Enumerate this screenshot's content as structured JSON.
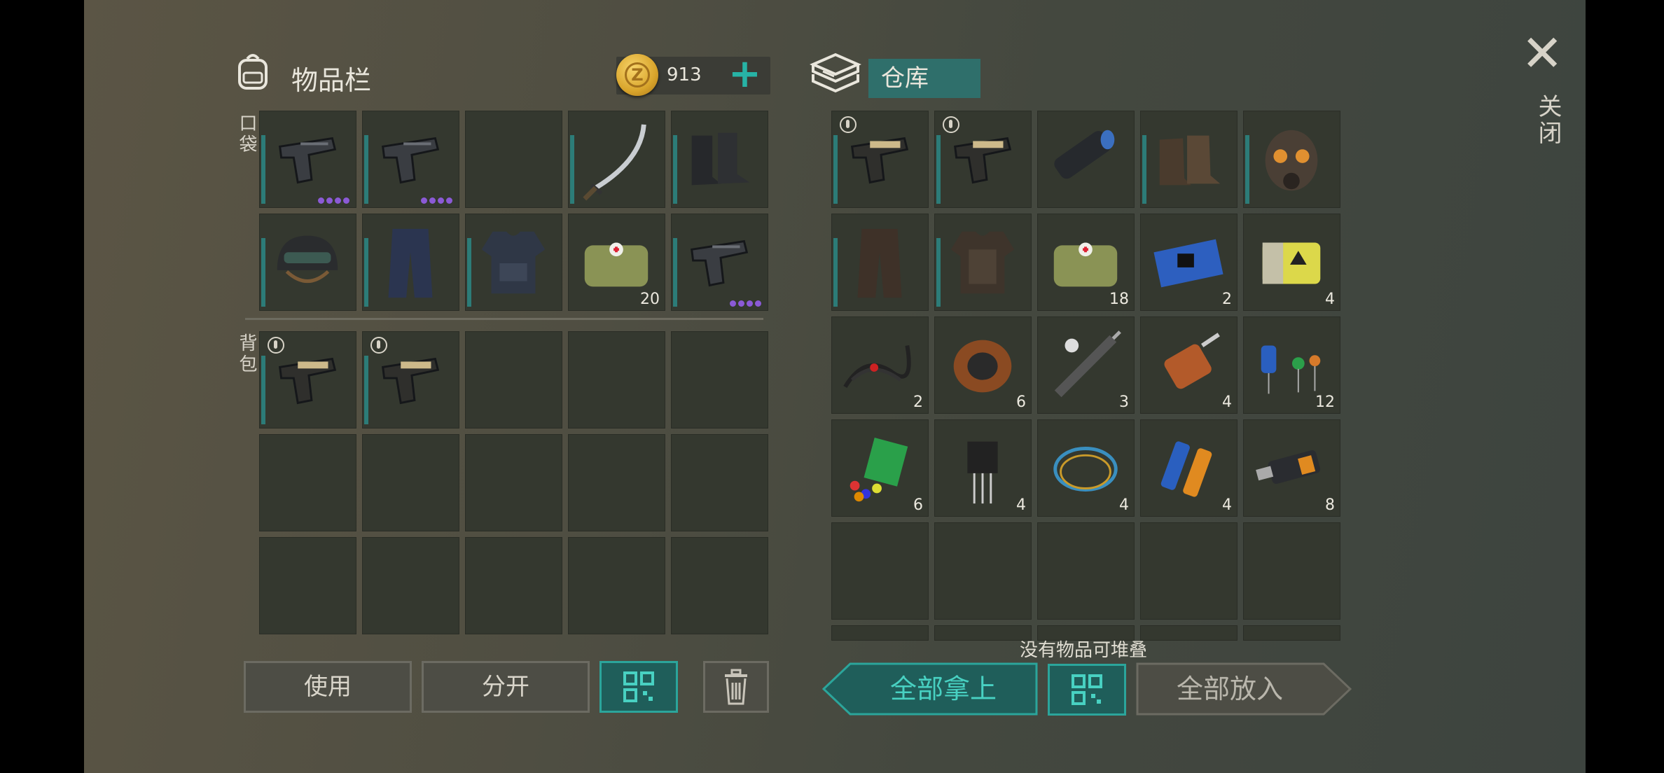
{
  "inventory": {
    "title": "物品栏",
    "coins": "913",
    "coin_letter": "Z",
    "pocket_label": "口袋",
    "backpack_label": "背包",
    "pockets": [
      {
        "icon": "pistol-icon",
        "count": "",
        "dots": 4,
        "badge": false,
        "dur": true
      },
      {
        "icon": "pistol-icon",
        "count": "",
        "dots": 4,
        "badge": false,
        "dur": true
      },
      {
        "icon": "",
        "count": "",
        "dots": 0,
        "badge": false,
        "dur": false
      },
      {
        "icon": "katana-icon",
        "count": "",
        "dots": 0,
        "badge": false,
        "dur": true
      },
      {
        "icon": "boots-icon",
        "count": "",
        "dots": 0,
        "badge": false,
        "dur": true
      },
      {
        "icon": "helmet-icon",
        "count": "",
        "dots": 0,
        "badge": false,
        "dur": true
      },
      {
        "icon": "pants-icon",
        "count": "",
        "dots": 0,
        "badge": false,
        "dur": true
      },
      {
        "icon": "vest-icon",
        "count": "",
        "dots": 0,
        "badge": false,
        "dur": true
      },
      {
        "icon": "medkit-icon",
        "count": "20",
        "dots": 0,
        "badge": false,
        "dur": false
      },
      {
        "icon": "pistol-icon",
        "count": "",
        "dots": 4,
        "badge": false,
        "dur": true
      }
    ],
    "backpack": [
      {
        "icon": "gold-pistol-icon",
        "count": "",
        "dots": 0,
        "badge": true,
        "dur": true
      },
      {
        "icon": "gold-pistol-icon",
        "count": "",
        "dots": 0,
        "badge": true,
        "dur": true
      },
      {
        "icon": "",
        "count": "",
        "dots": 0,
        "badge": false,
        "dur": false
      },
      {
        "icon": "",
        "count": "",
        "dots": 0,
        "badge": false,
        "dur": false
      },
      {
        "icon": "",
        "count": "",
        "dots": 0,
        "badge": false,
        "dur": false
      },
      {
        "icon": "",
        "count": "",
        "dots": 0,
        "badge": false,
        "dur": false
      },
      {
        "icon": "",
        "count": "",
        "dots": 0,
        "badge": false,
        "dur": false
      },
      {
        "icon": "",
        "count": "",
        "dots": 0,
        "badge": false,
        "dur": false
      },
      {
        "icon": "",
        "count": "",
        "dots": 0,
        "badge": false,
        "dur": false
      },
      {
        "icon": "",
        "count": "",
        "dots": 0,
        "badge": false,
        "dur": false
      },
      {
        "icon": "",
        "count": "",
        "dots": 0,
        "badge": false,
        "dur": false
      },
      {
        "icon": "",
        "count": "",
        "dots": 0,
        "badge": false,
        "dur": false
      },
      {
        "icon": "",
        "count": "",
        "dots": 0,
        "badge": false,
        "dur": false
      },
      {
        "icon": "",
        "count": "",
        "dots": 0,
        "badge": false,
        "dur": false
      },
      {
        "icon": "",
        "count": "",
        "dots": 0,
        "badge": false,
        "dur": false
      }
    ],
    "buttons": {
      "use": "使用",
      "split": "分开"
    }
  },
  "storage": {
    "title": "仓库",
    "items": [
      {
        "icon": "gold-pistol-icon",
        "count": "",
        "badge": true,
        "dur": true
      },
      {
        "icon": "gold-pistol-icon",
        "count": "",
        "badge": true,
        "dur": true
      },
      {
        "icon": "flashlight-icon",
        "count": "",
        "badge": false,
        "dur": false
      },
      {
        "icon": "leather-boots-icon",
        "count": "",
        "badge": false,
        "dur": true
      },
      {
        "icon": "gas-mask-icon",
        "count": "",
        "badge": false,
        "dur": true
      },
      {
        "icon": "leather-pants-icon",
        "count": "",
        "badge": false,
        "dur": true
      },
      {
        "icon": "leather-armor-icon",
        "count": "",
        "badge": false,
        "dur": true
      },
      {
        "icon": "medkit-icon",
        "count": "18",
        "badge": false,
        "dur": false
      },
      {
        "icon": "circuit-board-icon",
        "count": "2",
        "badge": false,
        "dur": false
      },
      {
        "icon": "battery-pack-icon",
        "count": "4",
        "badge": false,
        "dur": false
      },
      {
        "icon": "wires-icon",
        "count": "2",
        "badge": false,
        "dur": false
      },
      {
        "icon": "copper-coil-icon",
        "count": "6",
        "badge": false,
        "dur": false
      },
      {
        "icon": "soldering-iron-icon",
        "count": "3",
        "badge": false,
        "dur": false
      },
      {
        "icon": "electric-motor-icon",
        "count": "4",
        "badge": false,
        "dur": false
      },
      {
        "icon": "capacitors-icon",
        "count": "12",
        "badge": false,
        "dur": false
      },
      {
        "icon": "plastic-scraps-icon",
        "count": "6",
        "badge": false,
        "dur": false
      },
      {
        "icon": "transistor-icon",
        "count": "4",
        "badge": false,
        "dur": false
      },
      {
        "icon": "cable-icon",
        "count": "4",
        "badge": false,
        "dur": false
      },
      {
        "icon": "batteries-icon",
        "count": "4",
        "badge": false,
        "dur": false
      },
      {
        "icon": "usb-drive-icon",
        "count": "8",
        "badge": false,
        "dur": false
      },
      {
        "icon": "",
        "count": "",
        "badge": false,
        "dur": false
      },
      {
        "icon": "",
        "count": "",
        "badge": false,
        "dur": false
      },
      {
        "icon": "",
        "count": "",
        "badge": false,
        "dur": false
      },
      {
        "icon": "",
        "count": "",
        "badge": false,
        "dur": false
      },
      {
        "icon": "",
        "count": "",
        "badge": false,
        "dur": false
      },
      {
        "icon": "",
        "count": "",
        "badge": false,
        "dur": false,
        "partial": true
      },
      {
        "icon": "",
        "count": "",
        "badge": false,
        "dur": false,
        "partial": true
      },
      {
        "icon": "",
        "count": "",
        "badge": false,
        "dur": false,
        "partial": true
      },
      {
        "icon": "",
        "count": "",
        "badge": false,
        "dur": false,
        "partial": true
      },
      {
        "icon": "",
        "count": "",
        "badge": false,
        "dur": false,
        "partial": true
      }
    ],
    "stack_note": "没有物品可堆叠",
    "buttons": {
      "take_all": "全部拿上",
      "put_all": "全部放入"
    }
  },
  "close_label": "关闭",
  "colors": {
    "accent": "#2ba59b",
    "durability": "#2c7c78",
    "dots": "#8b5ad6",
    "coin": "#d9a52c"
  }
}
